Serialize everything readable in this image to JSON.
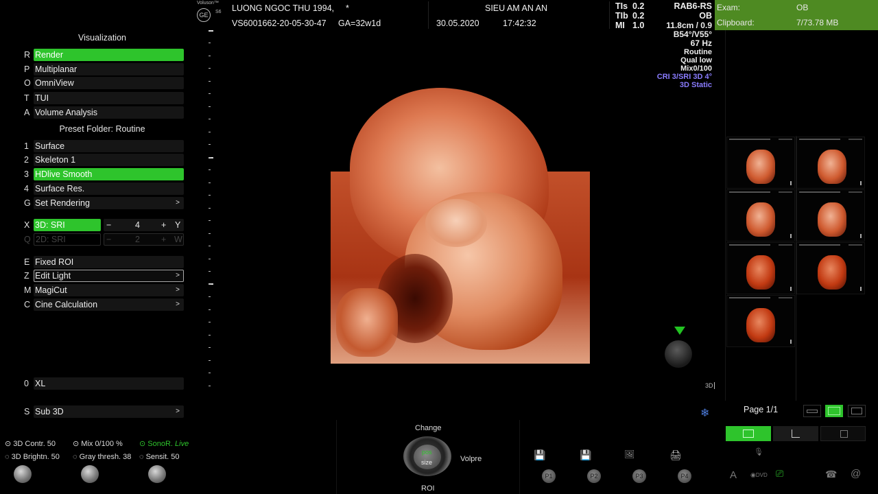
{
  "header": {
    "brand": "Voluson™",
    "brand_model": "S6",
    "patient": "LUONG NGOC THU 1994,",
    "asterisk": "*",
    "exam_id": "VS6001662-20-05-30-47",
    "ga": "GA=32w1d",
    "clinic": "SIEU AM AN AN",
    "date": "30.05.2020",
    "time": "17:42:32",
    "tis_label": "TIs",
    "tis_value": "0.2",
    "tib_label": "TIb",
    "tib_value": "0.2",
    "mi_label": "MI",
    "mi_value": "1.0",
    "probe": "RAB6-RS",
    "app": "OB"
  },
  "scan_params": [
    "11.8cm / 0.9",
    "B54°/V55°",
    "67 Hz",
    "Routine",
    "Qual low",
    "Mix0/100"
  ],
  "scan_params_accent": [
    "CRI 3/SRI 3D 4°",
    "3D Static"
  ],
  "accent_color": "#8a7cff",
  "sidebar": {
    "visualization_title": "Visualization",
    "visualization_items": [
      {
        "key": "R",
        "label": "Render"
      },
      {
        "key": "P",
        "label": "Multiplanar"
      },
      {
        "key": "O",
        "label": "OmniView"
      },
      {
        "key": "T",
        "label": "TUI"
      },
      {
        "key": "A",
        "label": "Volume Analysis"
      }
    ],
    "preset_title": "Preset Folder: Routine",
    "preset_items": [
      {
        "key": "1",
        "label": "Surface"
      },
      {
        "key": "2",
        "label": "Skeleton 1"
      },
      {
        "key": "3",
        "label": "HDlive Smooth"
      },
      {
        "key": "4",
        "label": "Surface Res."
      },
      {
        "key": "G",
        "label": "Set Rendering"
      }
    ],
    "sri_3d": {
      "key": "X",
      "label": "3D: SRI",
      "minus": "−",
      "value": "4",
      "plus": "+",
      "key2": "Y"
    },
    "sri_2d": {
      "key": "Q",
      "label": "2D: SRI",
      "minus": "−",
      "value": "2",
      "plus": "+",
      "key2": "W"
    },
    "tool_items": [
      {
        "key": "E",
        "label": "Fixed ROI"
      },
      {
        "key": "Z",
        "label": "Edit Light"
      },
      {
        "key": "M",
        "label": "MagiCut"
      },
      {
        "key": "C",
        "label": "Cine Calculation"
      }
    ],
    "xl": {
      "key": "0",
      "label": "XL"
    },
    "sub3d": {
      "key": "S",
      "label": "Sub 3D"
    },
    "arrow": ">"
  },
  "right_panel": {
    "exam_label": "Exam:",
    "exam_value": "OB",
    "clipboard_label": "Clipboard:",
    "clipboard_value": "7/73.78 MB",
    "page": "Page 1/1"
  },
  "view_label": "3D",
  "bottom": {
    "contr": "3D Contr. 50",
    "mix": "Mix 0/100 %",
    "sonor": "SonoR.",
    "sonor_live": "Live",
    "brightn": "3D Brightn. 50",
    "gray": "Gray thresh. 38",
    "sensit": "Sensit. 50",
    "change": "Change",
    "pos": "pos",
    "size": "size",
    "roi": "ROI",
    "volpre": "Volpre",
    "presets": [
      "P1",
      "P2",
      "P3",
      "P4"
    ],
    "dvd": "DVD"
  }
}
